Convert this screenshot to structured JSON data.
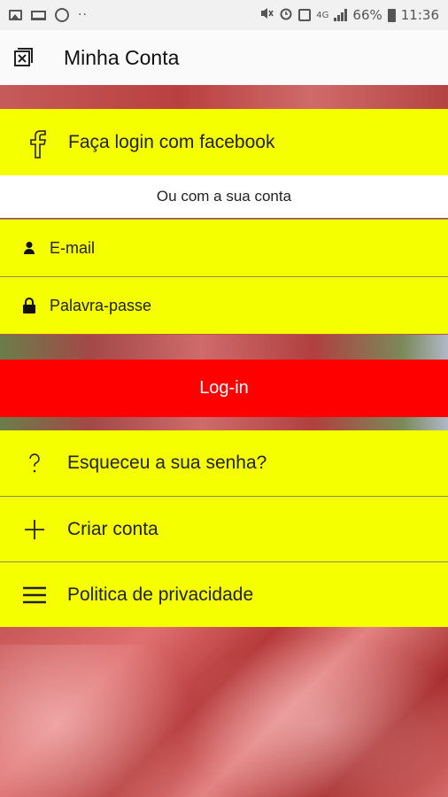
{
  "status_bar": {
    "battery": "66%",
    "time": "11:36",
    "network": "4G",
    "left_icons": [
      "image-icon",
      "laptop-icon",
      "account-circle-icon",
      "more-dots-icon"
    ],
    "right_icons": [
      "mute-icon",
      "alarm-icon",
      "nfc-icon",
      "signal-icon",
      "battery-icon"
    ]
  },
  "app_bar": {
    "title": "Minha Conta",
    "icon": "close-window-icon"
  },
  "facebook": {
    "label": "Faça login com facebook",
    "icon": "facebook-icon"
  },
  "divider_text": "Ou com a sua conta",
  "form": {
    "email_placeholder": "E-mail",
    "password_placeholder": "Palavra-passe",
    "email_icon": "person-icon",
    "password_icon": "lock-icon",
    "login_label": "Log-in"
  },
  "menu": {
    "forgot_label": "Esqueceu a sua senha?",
    "create_label": "Criar conta",
    "privacy_label": "Politica de privacidade"
  },
  "colors": {
    "row_background": "#f5ff00",
    "login_button": "#ff0000",
    "app_bar": "#fafafa"
  }
}
